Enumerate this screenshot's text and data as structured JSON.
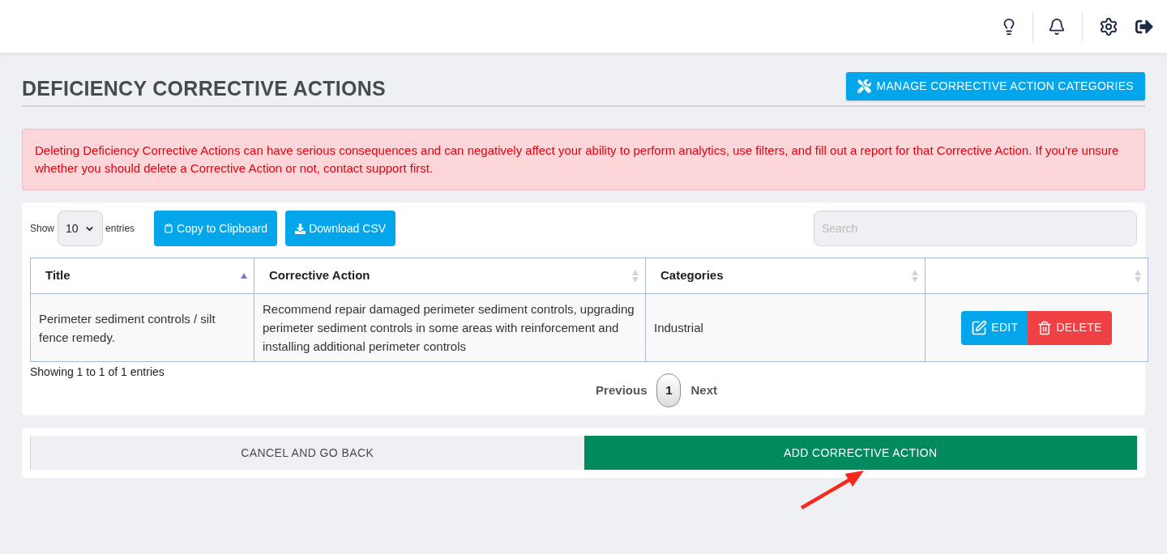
{
  "page": {
    "title": "DEFICIENCY CORRECTIVE ACTIONS",
    "manage_button": "MANAGE CORRECTIVE ACTION CATEGORIES"
  },
  "alert": {
    "text": "Deleting Deficiency Corrective Actions can have serious consequences and can negatively affect your ability to perform analytics, use filters, and fill out a report for that Corrective Action. If you're unsure whether you should delete a Corrective Action or not, contact support first."
  },
  "table_controls": {
    "show_label": "Show",
    "page_size": "10",
    "entries_label": "entries",
    "buttons": [
      {
        "label": "Copy to Clipboard",
        "kind": "copy"
      },
      {
        "label": "Download CSV",
        "kind": "download"
      }
    ],
    "search": {
      "placeholder": "Search"
    }
  },
  "table": {
    "columns": [
      {
        "label": "Title",
        "sorted": true
      },
      {
        "label": "Corrective Action",
        "sorted": false
      },
      {
        "label": "Categories",
        "sorted": false
      },
      {
        "sorted": false
      }
    ],
    "rows": [
      {
        "title": "Perimeter sediment controls / silt fence remedy.",
        "corrective_action": "Recommend repair damaged perimeter sediment controls, upgrading perimeter sediment controls in some areas with reinforcement and installing additional perimeter controls",
        "categories": "Industrial",
        "actions": [
          {
            "label": "EDIT",
            "kind": "edit"
          },
          {
            "label": "DELETE",
            "kind": "delete"
          }
        ]
      }
    ]
  },
  "info": "Showing 1 to 1 of 1 entries",
  "pagination": {
    "previous": "Previous",
    "pages": [
      {
        "label": "1",
        "selected": true
      }
    ],
    "next": "Next"
  },
  "footer_buttons": [
    {
      "label": "CANCEL AND GO BACK",
      "kind": "secondary"
    },
    {
      "label": "ADD CORRECTIVE ACTION",
      "kind": "primary"
    }
  ]
}
